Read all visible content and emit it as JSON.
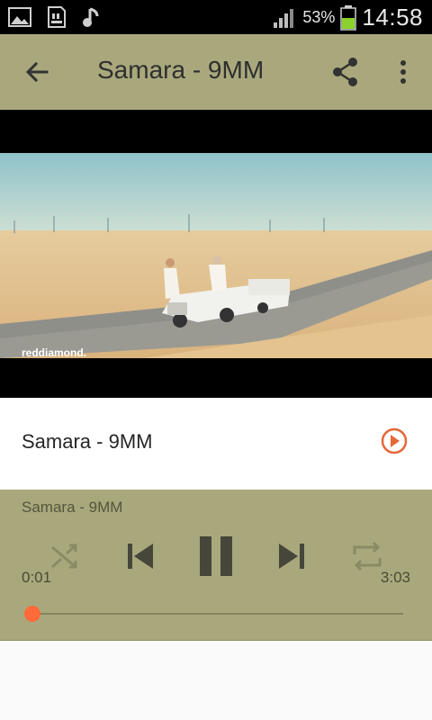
{
  "status_bar": {
    "icons": [
      "gallery-icon",
      "sd-card-icon",
      "music-note-icon",
      "signal-icon",
      "battery-icon"
    ],
    "battery_percent": "53%",
    "time": "14:58"
  },
  "app_bar": {
    "title": "Samara - 9MM",
    "icons": [
      "back-arrow-icon",
      "share-icon",
      "more-vert-icon"
    ],
    "color": "#a9a87c"
  },
  "video": {
    "watermark": "reddiamond."
  },
  "song_list": {
    "items": [
      {
        "title": "Samara - 9MM",
        "action_icon": "play-circle-icon"
      }
    ],
    "accent": "#e5673a"
  },
  "player": {
    "track_title": "Samara - 9MM",
    "elapsed": "0:01",
    "duration": "3:03",
    "progress": 0.005,
    "controls": [
      "shuffle-icon",
      "skip-previous-icon",
      "pause-icon",
      "skip-next-icon",
      "repeat-icon"
    ],
    "seek_color": "#ff6a3a"
  }
}
